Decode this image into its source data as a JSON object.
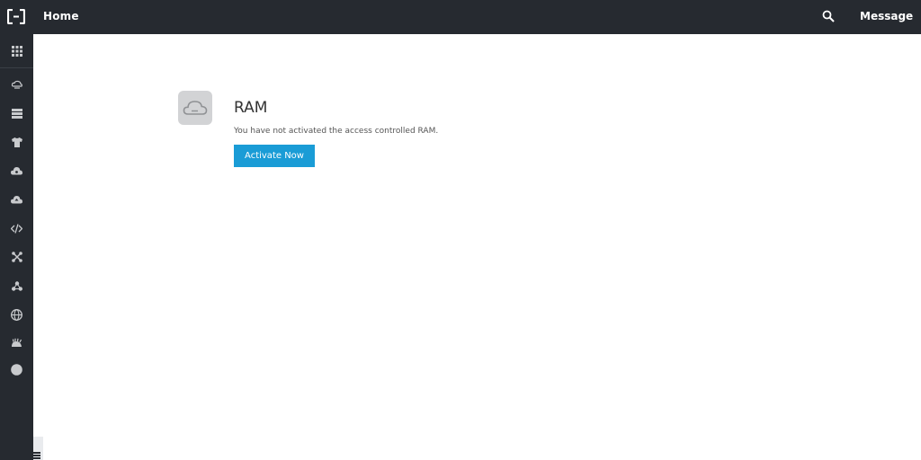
{
  "header": {
    "title": "Home",
    "logo_icon": "aliyun-logo-icon",
    "search_icon": "search-icon",
    "message_label": "Message"
  },
  "sidebar": {
    "top_icon": "grid-icon",
    "items": [
      {
        "icon": "cloud-server-icon"
      },
      {
        "icon": "database-icon"
      },
      {
        "icon": "shirt-icon"
      },
      {
        "icon": "cloud-icon"
      },
      {
        "icon": "cloud-upload-icon"
      },
      {
        "icon": "code-icon"
      },
      {
        "icon": "network-icon"
      },
      {
        "icon": "nodes-icon"
      },
      {
        "icon": "globe-icon"
      },
      {
        "icon": "hedgehog-icon"
      },
      {
        "icon": "circle-icon"
      }
    ]
  },
  "main": {
    "product_icon": "cloud-icon",
    "title": "RAM",
    "description": "You have not activated the access controlled RAM.",
    "activate_label": "Activate Now"
  },
  "colors": {
    "topbar": "#262a30",
    "accent": "#1a9cd6"
  }
}
